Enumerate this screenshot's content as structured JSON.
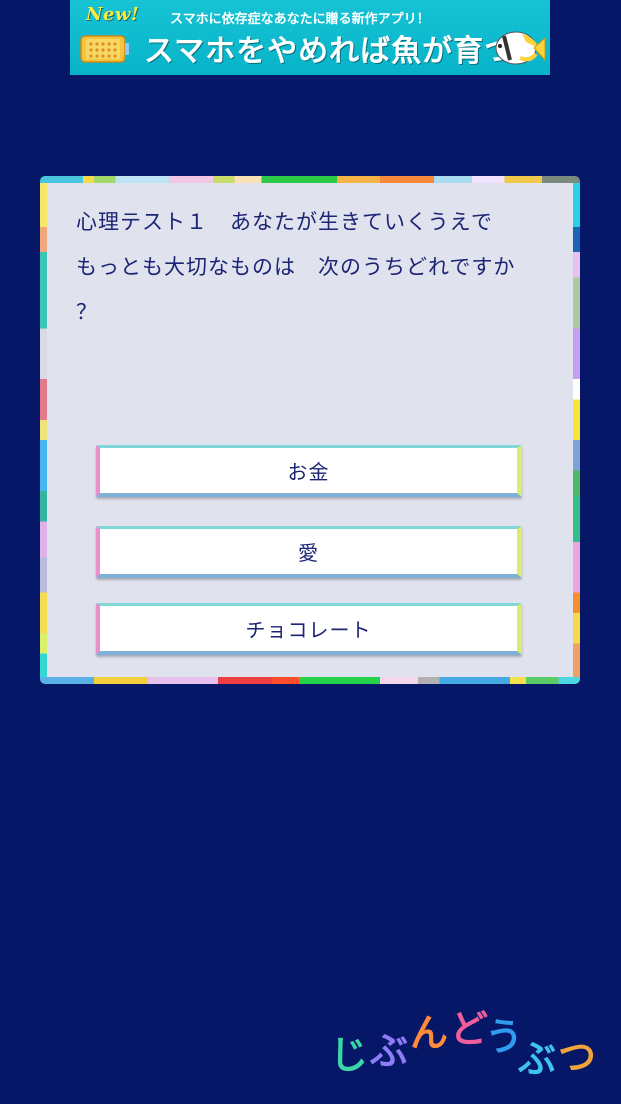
{
  "ad_banner": {
    "new_label": "New!",
    "subtitle": "スマホに依存症なあなたに贈る新作アプリ！",
    "headline": "スマホをやめれば魚が育つ",
    "background_color": "#10bccf",
    "icons": [
      "phone-icon",
      "fish-icon"
    ]
  },
  "quiz": {
    "question": "心理テスト１　あなたが生きていくうえで\nもっとも大切なものは　次のうちどれですか\n？",
    "answers": [
      {
        "label": "お金"
      },
      {
        "label": "愛"
      },
      {
        "label": "チョコレート"
      }
    ],
    "card_background": "#e0e2ee",
    "text_color": "#1c2575"
  },
  "logo": {
    "chars": [
      "じ",
      "ぶ",
      "ん",
      "ど",
      "う",
      "ぶ",
      "つ"
    ],
    "colors": [
      "#3bd6a8",
      "#8c7cf5",
      "#ff8a3a",
      "#ef5d9b",
      "#2f9cf0",
      "#3fc2ef",
      "#f0a43a"
    ]
  },
  "colors": {
    "page_background": "#061768"
  }
}
